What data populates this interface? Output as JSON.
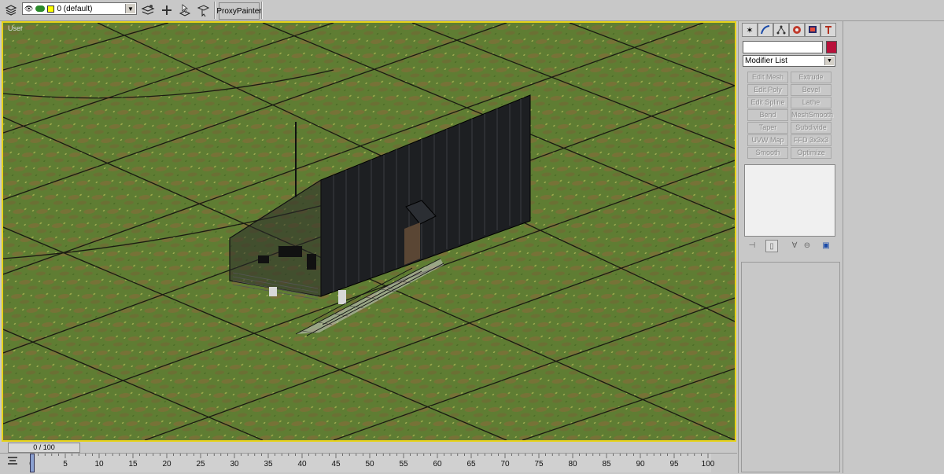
{
  "toolbar": {
    "layer_value": "0 (default)",
    "proxy_label": "ProxyPainter",
    "icons": [
      "layers-icon",
      "eye-icon",
      "freeze-icon",
      "box-icon",
      "layer-settings-icon",
      "add-layer-icon",
      "select-layer-icon",
      "set-current-icon"
    ]
  },
  "viewport": {
    "label": "User",
    "border_color": "#e6d21a",
    "ground_color": "#5d7a32"
  },
  "command_panel": {
    "tabs": [
      "create-icon",
      "modify-icon",
      "hierarchy-icon",
      "motion-icon",
      "display-icon",
      "utilities-icon"
    ],
    "name_value": "",
    "object_color": "#b8103a",
    "modifier_list": "Modifier List",
    "modifier_buttons": [
      [
        "Edit Mesh",
        "Extrude"
      ],
      [
        "Edit Poly",
        "Bevel"
      ],
      [
        "Edit Spline",
        "Lathe"
      ],
      [
        "Bend",
        "MeshSmooth"
      ],
      [
        "Taper",
        "Subdivide"
      ],
      [
        "UVW Map",
        "FFD 3x3x3"
      ],
      [
        "Smooth",
        "Optimize"
      ]
    ]
  },
  "timeline": {
    "frame_display": "0 / 100",
    "ticks": [
      "0",
      "5",
      "10",
      "15",
      "20",
      "25",
      "30",
      "35",
      "40",
      "45",
      "50",
      "55",
      "60",
      "65",
      "70",
      "75",
      "80",
      "85",
      "90",
      "95",
      "100"
    ]
  }
}
